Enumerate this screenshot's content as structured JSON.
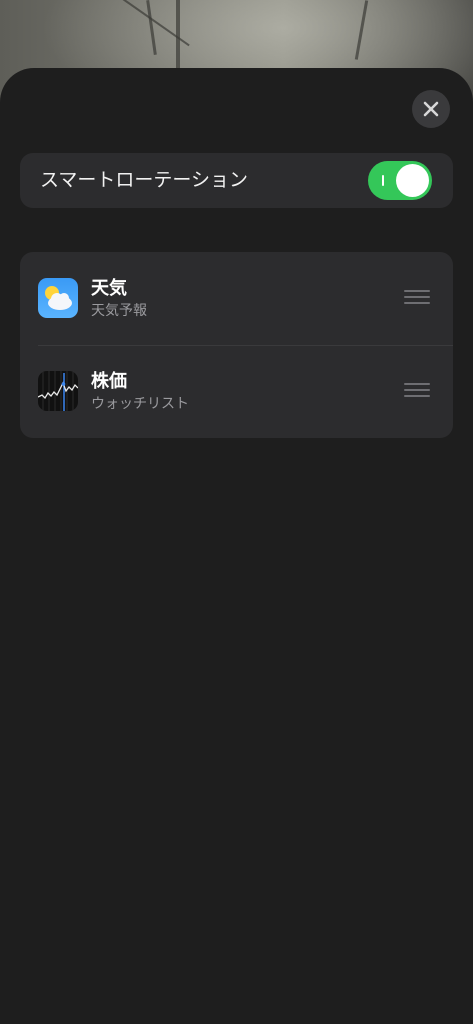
{
  "header": {
    "close_icon": "close-icon"
  },
  "smart_rotation": {
    "label": "スマートローテーション",
    "enabled": true,
    "toggle_color": "#34c759"
  },
  "widgets": [
    {
      "title": "天気",
      "subtitle": "天気予報",
      "icon": "weather-app-icon"
    },
    {
      "title": "株価",
      "subtitle": "ウォッチリスト",
      "icon": "stocks-app-icon"
    }
  ]
}
